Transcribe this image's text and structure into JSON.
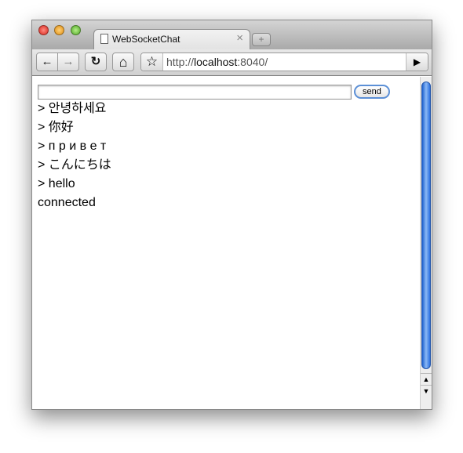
{
  "tab": {
    "title": "WebSocketChat"
  },
  "toolbar": {
    "back": "←",
    "forward": "→",
    "reload": "↻",
    "home": "⌂",
    "url_scheme": "http://",
    "url_host": "localhost",
    "url_rest": ":8040/",
    "go": "▶"
  },
  "form": {
    "input_value": "",
    "send_label": "send"
  },
  "messages": [
    "> 안녕하세요",
    "> 你好",
    "> п р и в е т",
    "> こんにちは",
    "> hello",
    "connected"
  ],
  "colors": {
    "scrollbar": "#2a6fe0",
    "focus_ring": "#5b8fd6"
  }
}
